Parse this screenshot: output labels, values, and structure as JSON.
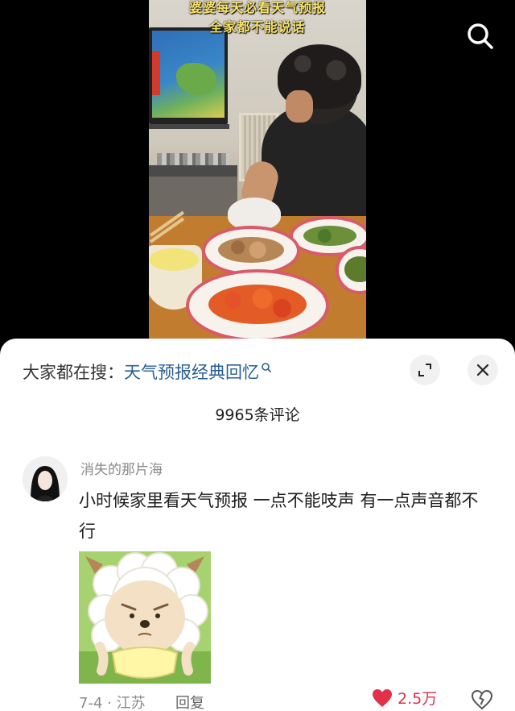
{
  "video": {
    "caption_line1": "婆婆每天必看天气预报",
    "caption_line2": "全家都不能说话"
  },
  "header": {
    "trending_prefix": "大家都在搜：",
    "trending_query": "天气预报经典回忆",
    "comment_count": "9965条评论"
  },
  "comment": {
    "username": "消失的那片海",
    "text": "小时候家里看天气预报 一点不能吱声 有一点声音都不行",
    "date_location": "7-4 · 江苏",
    "reply_label": "回复",
    "like_count": "2.5万"
  },
  "colors": {
    "caption": "#f7e36a",
    "link": "#2a5f96",
    "like": "#e0304a"
  },
  "icons": [
    "search-icon",
    "expand-icon",
    "close-icon",
    "heart-icon",
    "broken-heart-icon"
  ]
}
